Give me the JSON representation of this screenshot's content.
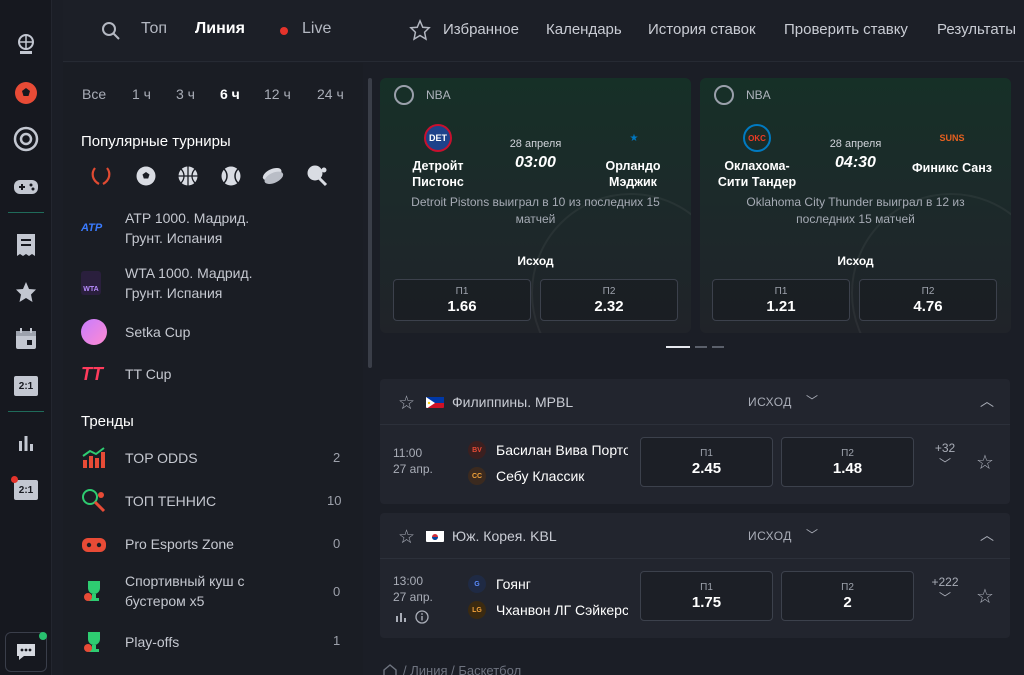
{
  "rail": {
    "icons": [
      "basketball-ball-icon",
      "football-ball-icon",
      "target-icon",
      "gamepad-icon",
      "receipt-icon",
      "star-icon",
      "calendar-icon",
      "score-2-1-icon",
      "stats-bars-icon",
      "score-2-1-live-icon",
      "chat-icon"
    ],
    "score_badge": "2:1",
    "score_badge_2": "2:1"
  },
  "topbar": {
    "tab_top": "Топ",
    "tab_line": "Линия",
    "tab_live": "Live",
    "favorites": "Избранное",
    "calendar": "Календарь",
    "history": "История ставок",
    "check_bet": "Проверить ставку",
    "results": "Результаты"
  },
  "time_filters": [
    "Все",
    "1 ч",
    "3 ч",
    "6 ч",
    "12 ч",
    "24 ч"
  ],
  "time_filter_active": "6 ч",
  "popular": {
    "title": "Популярные турниры",
    "tournaments": [
      {
        "label_1": "ATP 1000. Мадрид.",
        "label_2": "Грунт. Испания",
        "logo": "ATP"
      },
      {
        "label_1": "WTA 1000. Мадрид.",
        "label_2": "Грунт. Испания",
        "logo": "WTA"
      },
      {
        "label_1": "Setka Cup",
        "label_2": "",
        "logo": "setka"
      },
      {
        "label_1": "TT Cup",
        "label_2": "",
        "logo": "TT"
      }
    ]
  },
  "trends": {
    "title": "Тренды",
    "items": [
      {
        "label_1": "TOP ODDS",
        "label_2": "",
        "count": "2"
      },
      {
        "label_1": "ТОП ТЕННИС",
        "label_2": "",
        "count": "10"
      },
      {
        "label_1": "Pro Esports Zone",
        "label_2": "",
        "count": "0"
      },
      {
        "label_1": "Спортивный куш с",
        "label_2": "бустером х5",
        "count": "0"
      },
      {
        "label_1": "Play-offs",
        "label_2": "",
        "count": "1"
      }
    ]
  },
  "featured": [
    {
      "league": "NBA",
      "home_1": "Детройт",
      "home_2": "Пистонс",
      "away_1": "Орландо",
      "away_2": "Мэджик",
      "date": "28 апреля",
      "time": "03:00",
      "stat": "Detroit Pistons выиграл в 10 из последних 15 матчей",
      "outcome": "Исход",
      "p1_label": "П1",
      "p1": "1.66",
      "p2_label": "П2",
      "p2": "2.32"
    },
    {
      "league": "NBA",
      "home_1": "Оклахома-",
      "home_2": "Сити Тандер",
      "away_1": "Финикс Санз",
      "away_2": "",
      "date": "28 апреля",
      "time": "04:30",
      "stat": "Oklahoma City Thunder выиграл в 12 из последних 15 матчей",
      "outcome": "Исход",
      "p1_label": "П1",
      "p1": "1.21",
      "p2_label": "П2",
      "p2": "4.76"
    }
  ],
  "leagues": [
    {
      "name": "Филиппины. MPBL",
      "market": "ИСХОД",
      "match": {
        "time": "11:00",
        "date": "27 апр.",
        "home": "Басилан Вива Портовые",
        "away": "Себу Классик",
        "p1_label": "П1",
        "p1": "2.45",
        "p2_label": "П2",
        "p2": "1.48",
        "more": "+32"
      }
    },
    {
      "name": "Юж. Корея. KBL",
      "market": "ИСХОД",
      "match": {
        "time": "13:00",
        "date": "27 апр.",
        "home": "Гоянг",
        "away": "Чханвон ЛГ Сэйкерс",
        "p1_label": "П1",
        "p1": "1.75",
        "p2_label": "П2",
        "p2": "2",
        "more": "+222"
      }
    }
  ],
  "breadcrumb": "/ Линия / Баскетбол",
  "colors": {
    "accent_red": "#e84b36",
    "live_red": "#e4332b",
    "background": "#1b1e26",
    "card": "#22252e"
  }
}
